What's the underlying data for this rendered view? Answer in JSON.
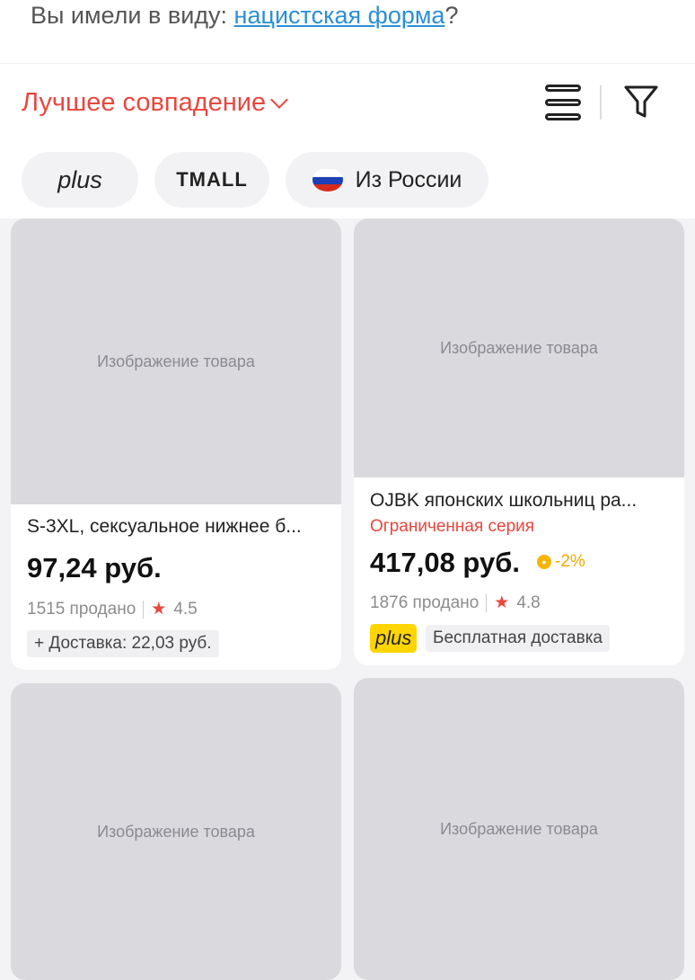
{
  "suggestion": {
    "prefix": "Вы имели в виду: ",
    "link": "нацистская форма",
    "suffix": "?"
  },
  "toolbar": {
    "sort_label": "Лучшее совпадение",
    "chips": {
      "plus": "plus",
      "tmall": "TMALL",
      "russia": "Из России"
    }
  },
  "colors": {
    "accent": "#e8473f",
    "link": "#2b8fd6",
    "plus_yellow": "#ffd500",
    "rating_star": "#e8473f"
  },
  "products": [
    {
      "image": "Изображение товара",
      "title": "S-3XL, сексуальное нижнее б...",
      "price": "97,24 руб.",
      "sold": "1515 продано",
      "rating": "4.5",
      "delivery": "+ Доставка: 22,03 руб."
    },
    {
      "image": "Изображение товара",
      "title": "OJBK японских школьниц ра...",
      "limited": "Ограниченная серия",
      "price": "417,08 руб.",
      "discount": "-2%",
      "sold": "1876 продано",
      "rating": "4.8",
      "plus_badge": "plus",
      "delivery": "Бесплатная доставка"
    },
    {
      "image": "Изображение товара"
    },
    {
      "image": "Изображение товара"
    }
  ]
}
